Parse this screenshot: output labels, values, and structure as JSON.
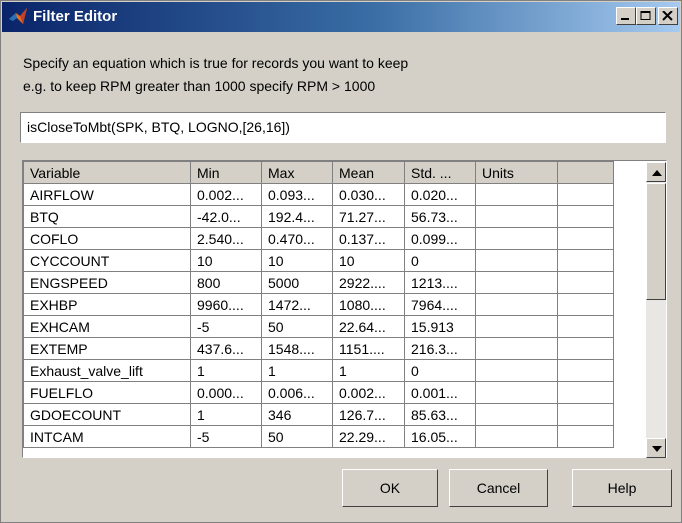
{
  "window": {
    "title": "Filter Editor"
  },
  "instructions": {
    "line1": "Specify an equation which is true for records you want to keep",
    "line2": "e.g. to keep RPM greater than 1000 specify RPM > 1000"
  },
  "equation": {
    "value": "isCloseToMbt(SPK, BTQ, LOGNO,[26,16])"
  },
  "table": {
    "headers": [
      "Variable",
      "Min",
      "Max",
      "Mean",
      "Std. ...",
      "Units",
      ""
    ],
    "rows": [
      [
        "AIRFLOW",
        "0.002...",
        "0.093...",
        "0.030...",
        "0.020...",
        "",
        ""
      ],
      [
        "BTQ",
        "-42.0...",
        "192.4...",
        "71.27...",
        "56.73...",
        "",
        ""
      ],
      [
        "COFLO",
        "2.540...",
        "0.470...",
        "0.137...",
        "0.099...",
        "",
        ""
      ],
      [
        "CYCCOUNT",
        "10",
        "10",
        "10",
        "0",
        "",
        ""
      ],
      [
        "ENGSPEED",
        "800",
        "5000",
        "2922....",
        "1213....",
        "",
        ""
      ],
      [
        "EXHBP",
        "9960....",
        "1472...",
        "1080....",
        "7964....",
        "",
        ""
      ],
      [
        "EXHCAM",
        "-5",
        "50",
        "22.64...",
        "15.913",
        "",
        ""
      ],
      [
        "EXTEMP",
        "437.6...",
        "1548....",
        "1151....",
        "216.3...",
        "",
        ""
      ],
      [
        "Exhaust_valve_lift",
        "1",
        "1",
        "1",
        "0",
        "",
        ""
      ],
      [
        "FUELFLO",
        "0.000...",
        "0.006...",
        "0.002...",
        "0.001...",
        "",
        ""
      ],
      [
        "GDOECOUNT",
        "1",
        "346",
        "126.7...",
        "85.63...",
        "",
        ""
      ],
      [
        "INTCAM",
        "-5",
        "50",
        "22.29...",
        "16.05...",
        "",
        ""
      ]
    ]
  },
  "buttons": {
    "ok": "OK",
    "cancel": "Cancel",
    "help": "Help"
  },
  "icons": {
    "app": "matlab-icon",
    "minimize": "minimize-icon",
    "maximize": "maximize-icon",
    "close": "close-icon"
  }
}
